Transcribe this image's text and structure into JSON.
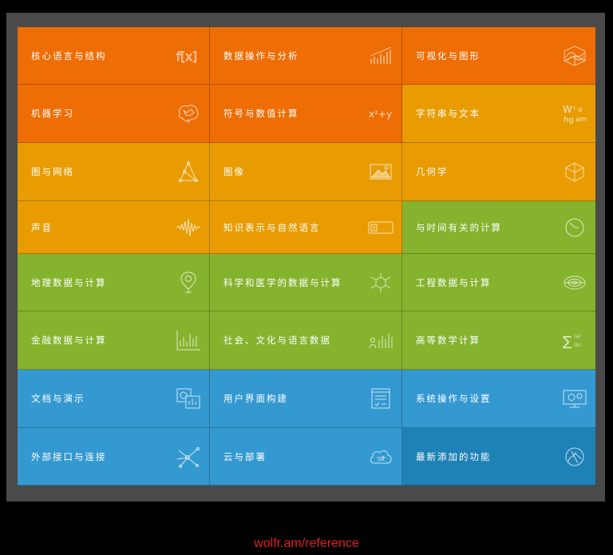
{
  "colors": {
    "orange": "#ee6d04",
    "amber": "#e89c02",
    "green": "#85b32e",
    "blue": "#3499d1",
    "dark_blue": "#1f82b6",
    "link": "#e02020"
  },
  "tiles": [
    {
      "label": "核心语言与结构",
      "icon": "function-fx-icon"
    },
    {
      "label": "数据操作与分析",
      "icon": "bar-chart-icon"
    },
    {
      "label": "可视化与图形",
      "icon": "3d-surface-plot-icon"
    },
    {
      "label": "机器学习",
      "icon": "brain-icon"
    },
    {
      "label": "符号与数值计算",
      "icon": "formula-icon"
    },
    {
      "label": "字符串与文本",
      "icon": "text-letters-icon"
    },
    {
      "label": "图与网络",
      "icon": "graph-network-icon"
    },
    {
      "label": "图像",
      "icon": "image-icon"
    },
    {
      "label": "几何学",
      "icon": "geometry-polyhedron-icon"
    },
    {
      "label": "声音",
      "icon": "sound-wave-icon"
    },
    {
      "label": "知识表示与自然语言",
      "icon": "knowledge-card-icon"
    },
    {
      "label": "与时间有关的计算",
      "icon": "clock-icon"
    },
    {
      "label": "地理数据与计算",
      "icon": "map-pin-icon"
    },
    {
      "label": "科学和医学的数据与计算",
      "icon": "molecule-icon"
    },
    {
      "label": "工程数据与计算",
      "icon": "engineering-part-icon"
    },
    {
      "label": "金融数据与计算",
      "icon": "stock-chart-icon"
    },
    {
      "label": "社会、文化与语言数据",
      "icon": "people-chart-icon"
    },
    {
      "label": "高等数学计算",
      "icon": "summation-icon"
    },
    {
      "label": "文档与演示",
      "icon": "document-presentation-icon"
    },
    {
      "label": "用户界面构建",
      "icon": "ui-form-icon"
    },
    {
      "label": "系统操作与设置",
      "icon": "monitor-gears-icon"
    },
    {
      "label": "外部接口与连接",
      "icon": "network-hub-icon"
    },
    {
      "label": "云与部署",
      "icon": "cloud-icon"
    },
    {
      "label": "最新添加的功能",
      "icon": "new-features-icon"
    }
  ],
  "footer": {
    "link_text": "wolfr.am/reference"
  }
}
